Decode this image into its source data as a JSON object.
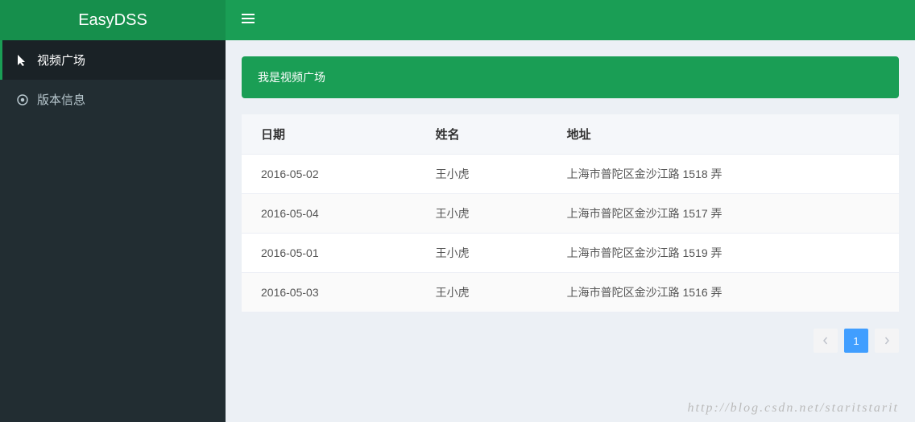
{
  "header": {
    "logo": "EasyDSS"
  },
  "sidebar": {
    "items": [
      {
        "label": "视频广场",
        "icon": "cursor"
      },
      {
        "label": "版本信息",
        "icon": "circle-dot"
      }
    ]
  },
  "main": {
    "banner": "我是视频广场",
    "table": {
      "headers": [
        "日期",
        "姓名",
        "地址"
      ],
      "rows": [
        {
          "date": "2016-05-02",
          "name": "王小虎",
          "address": "上海市普陀区金沙江路 1518 弄"
        },
        {
          "date": "2016-05-04",
          "name": "王小虎",
          "address": "上海市普陀区金沙江路 1517 弄"
        },
        {
          "date": "2016-05-01",
          "name": "王小虎",
          "address": "上海市普陀区金沙江路 1519 弄"
        },
        {
          "date": "2016-05-03",
          "name": "王小虎",
          "address": "上海市普陀区金沙江路 1516 弄"
        }
      ]
    },
    "pagination": {
      "current": "1"
    }
  },
  "watermark": "http://blog.csdn.net/staritstarit"
}
